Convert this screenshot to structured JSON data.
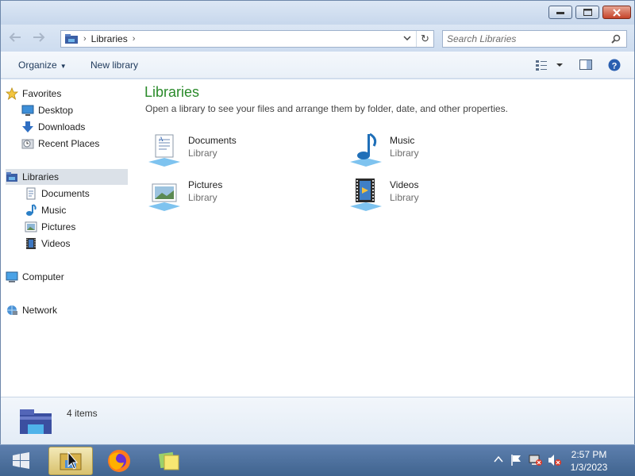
{
  "navigation": {
    "back_icon": "back-arrow-icon",
    "forward_icon": "forward-arrow-icon",
    "breadcrumb": "Libraries",
    "search_placeholder": "Search Libraries"
  },
  "toolbar": {
    "organize": "Organize",
    "new_library": "New library"
  },
  "sidebar": {
    "favorites": {
      "header": "Favorites",
      "items": [
        {
          "label": "Desktop",
          "icon": "desktop-icon"
        },
        {
          "label": "Downloads",
          "icon": "downloads-icon"
        },
        {
          "label": "Recent Places",
          "icon": "recent-places-icon"
        }
      ]
    },
    "libraries": {
      "header": "Libraries",
      "items": [
        {
          "label": "Documents",
          "icon": "documents-icon"
        },
        {
          "label": "Music",
          "icon": "music-icon"
        },
        {
          "label": "Pictures",
          "icon": "pictures-icon"
        },
        {
          "label": "Videos",
          "icon": "videos-icon"
        }
      ]
    },
    "computer": "Computer",
    "network": "Network"
  },
  "main": {
    "title": "Libraries",
    "description": "Open a library to see your files and arrange them by folder, date, and other properties.",
    "libraries": [
      {
        "name": "Documents",
        "type": "Library",
        "icon": "documents-library-icon"
      },
      {
        "name": "Music",
        "type": "Library",
        "icon": "music-library-icon"
      },
      {
        "name": "Pictures",
        "type": "Library",
        "icon": "pictures-library-icon"
      },
      {
        "name": "Videos",
        "type": "Library",
        "icon": "videos-library-icon"
      }
    ]
  },
  "details": {
    "count": "4 items"
  },
  "taskbar": {
    "clock": {
      "time": "2:57 PM",
      "date": "1/3/2023"
    }
  },
  "colors": {
    "title_green": "#2a8a2a",
    "selection": "#dbe1e8",
    "taskbar": "#40648f"
  }
}
